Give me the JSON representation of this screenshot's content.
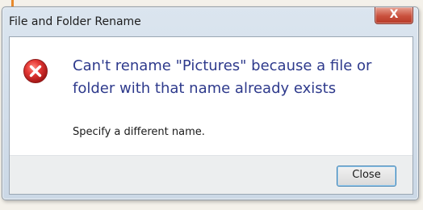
{
  "window": {
    "title": "File and Folder Rename",
    "close_glyph": "X"
  },
  "message": {
    "icon": "error-icon",
    "main_instruction": "Can't rename \"Pictures\" because a file or folder with that name already exists",
    "sub_text": "Specify a different name."
  },
  "buttons": {
    "close_label": "Close"
  },
  "colors": {
    "instruction_text": "#2e3a8c",
    "error_icon": "#c62828",
    "close_x_button": "#c9503d"
  }
}
